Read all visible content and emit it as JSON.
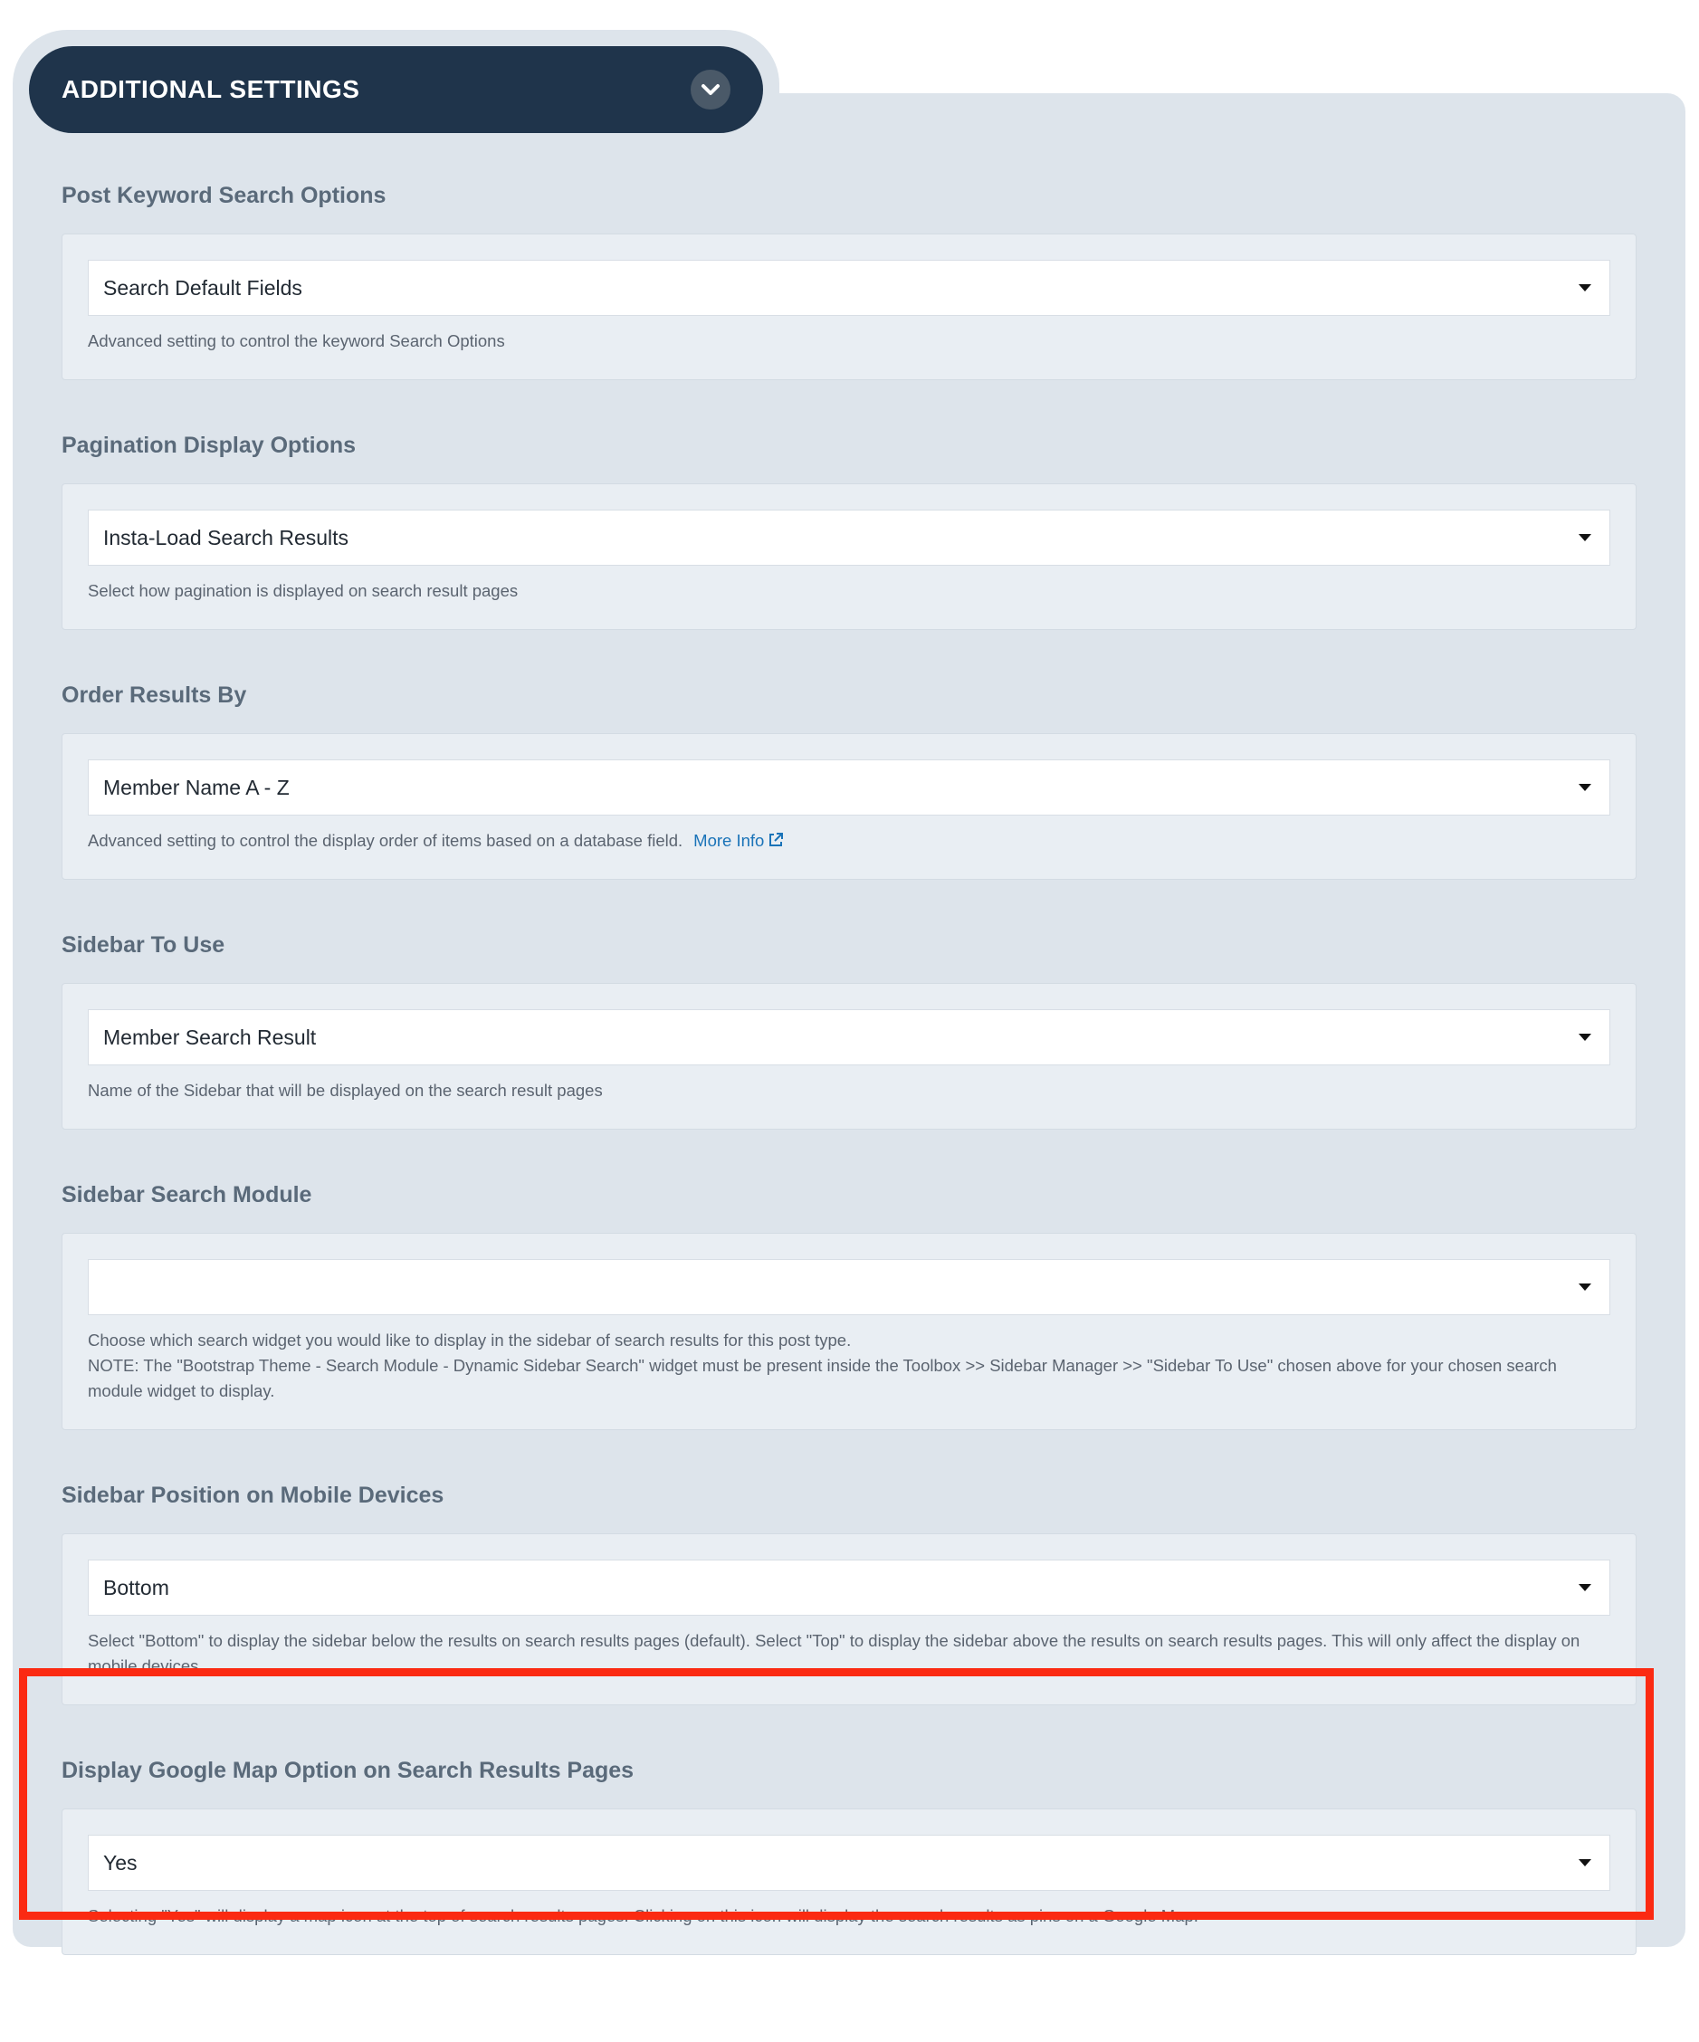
{
  "header": {
    "title": "ADDITIONAL SETTINGS",
    "toggle_icon": "chevron-down-icon"
  },
  "sections": [
    {
      "id": "post-keyword-search",
      "title": "Post Keyword Search Options",
      "value": "Search Default Fields",
      "help": [
        "Advanced setting to control the keyword Search Options"
      ]
    },
    {
      "id": "pagination-display",
      "title": "Pagination Display Options",
      "value": "Insta-Load Search Results",
      "help": [
        "Select how pagination is displayed on search result pages"
      ]
    },
    {
      "id": "order-results",
      "title": "Order Results By",
      "value": "Member Name A - Z",
      "help": [
        "Advanced setting to control the display order of items based on a database field."
      ],
      "link": "More Info"
    },
    {
      "id": "sidebar-to-use",
      "title": "Sidebar To Use",
      "value": "Member Search Result",
      "help": [
        "Name of the Sidebar that will be displayed on the search result pages"
      ]
    },
    {
      "id": "sidebar-search-module",
      "title": "Sidebar Search Module",
      "value": "",
      "help": [
        "Choose which search widget you would like to display in the sidebar of search results for this post type.",
        "NOTE: The \"Bootstrap Theme - Search Module - Dynamic Sidebar Search\" widget must be present inside the Toolbox >> Sidebar Manager >> \"Sidebar To Use\" chosen above for your chosen search module widget to display."
      ]
    },
    {
      "id": "sidebar-position-mobile",
      "title": "Sidebar Position on Mobile Devices",
      "value": "Bottom",
      "help": [
        "Select \"Bottom\" to display the sidebar below the results on search results pages (default). Select \"Top\" to display the sidebar above the results on search results pages. This will only affect the display on mobile devices."
      ]
    },
    {
      "id": "display-google-map",
      "title": "Display Google Map Option on Search Results Pages",
      "value": "Yes",
      "help": [
        "Selecting \"Yes\" will display a map icon at the top of search results pages. Clicking on this icon will display the search results as pins on a Google Map."
      ]
    }
  ],
  "colors": {
    "header_bg": "#1f344b",
    "panel_bg": "#dde4eb",
    "link": "#1a73b8",
    "highlight_border": "#fb2a12"
  }
}
